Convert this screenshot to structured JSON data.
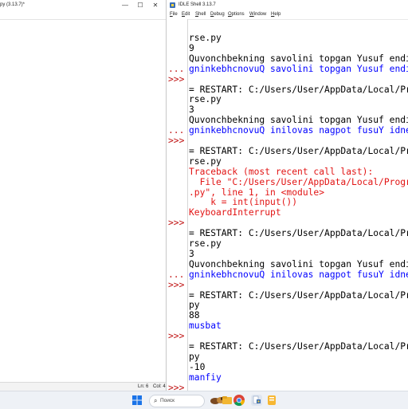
{
  "left_window": {
    "title": "py (3.13.7)*",
    "controls": {
      "minimize": "—",
      "maximize": "☐",
      "close": "✕"
    },
    "status": {
      "line": "Ln: 6",
      "col": "Col: 4"
    }
  },
  "right_window": {
    "title": "IDLE Shell 3.13.7",
    "menu": [
      "File",
      "Edit",
      "Shell",
      "Debug",
      "Options",
      "Window",
      "Help"
    ],
    "lines": [
      {
        "text": "rse.py",
        "style": "out"
      },
      {
        "text": "9",
        "style": "out"
      },
      {
        "text": "Quvonchbekning savolini topgan Yusuf endi",
        "style": "out"
      },
      {
        "text": "gninkebhcnovuQ savolini topgan Yusuf endi",
        "style": "stdout"
      },
      {
        "text": "",
        "style": "out"
      },
      {
        "text": "= RESTART: C:/Users/User/AppData/Local/Pro",
        "style": "out"
      },
      {
        "text": "rse.py",
        "style": "out"
      },
      {
        "text": "3",
        "style": "out"
      },
      {
        "text": "Quvonchbekning savolini topgan Yusuf endi",
        "style": "out"
      },
      {
        "text": "gninkebhcnovuQ inilovas nagpot fusuY idne",
        "style": "stdout"
      },
      {
        "text": "",
        "style": "out"
      },
      {
        "text": "= RESTART: C:/Users/User/AppData/Local/Pro",
        "style": "out"
      },
      {
        "text": "rse.py",
        "style": "out"
      },
      {
        "text": "Traceback (most recent call last):",
        "style": "err"
      },
      {
        "text": "  File \"C:/Users/User/AppData/Local/Progra",
        "style": "err"
      },
      {
        "text": ".py\", line 1, in <module>",
        "style": "err"
      },
      {
        "text": "    k = int(input())",
        "style": "err"
      },
      {
        "text": "KeyboardInterrupt",
        "style": "err"
      },
      {
        "text": "",
        "style": "out"
      },
      {
        "text": "= RESTART: C:/Users/User/AppData/Local/Pro",
        "style": "out"
      },
      {
        "text": "rse.py",
        "style": "out"
      },
      {
        "text": "3",
        "style": "out"
      },
      {
        "text": "Quvonchbekning savolini topgan Yusuf endi",
        "style": "out"
      },
      {
        "text": "gninkebhcnovuQ inilovas nagpot fusuY idne",
        "style": "stdout"
      },
      {
        "text": "",
        "style": "out"
      },
      {
        "text": "= RESTART: C:/Users/User/AppData/Local/Pro",
        "style": "out"
      },
      {
        "text": "py",
        "style": "out"
      },
      {
        "text": "88",
        "style": "out"
      },
      {
        "text": "musbat",
        "style": "stdout"
      },
      {
        "text": "",
        "style": "out"
      },
      {
        "text": "= RESTART: C:/Users/User/AppData/Local/Pro",
        "style": "out"
      },
      {
        "text": "py",
        "style": "out"
      },
      {
        "text": "-10",
        "style": "out"
      },
      {
        "text": "manfiy",
        "style": "stdout"
      },
      {
        "text": "",
        "style": "out"
      }
    ],
    "gutter_marks": [
      {
        "row": 3,
        "text": "..."
      },
      {
        "row": 4,
        "text": ">>>"
      },
      {
        "row": 9,
        "text": "..."
      },
      {
        "row": 10,
        "text": ">>>"
      },
      {
        "row": 18,
        "text": ">>>"
      },
      {
        "row": 23,
        "text": "..."
      },
      {
        "row": 24,
        "text": ">>>"
      },
      {
        "row": 29,
        "text": ">>>"
      },
      {
        "row": 34,
        "text": ">>>"
      }
    ]
  },
  "taskbar": {
    "search_placeholder": "Поиск",
    "icons": [
      "windows-start-icon",
      "search-icon",
      "widgets-icon",
      "file-explorer-icon",
      "chrome-icon",
      "python-idle-icon",
      "notes-app-icon"
    ]
  },
  "colors": {
    "prompt": "#c01212",
    "stdout": "#0000ff",
    "stderr": "#e21414",
    "output": "#000000"
  }
}
